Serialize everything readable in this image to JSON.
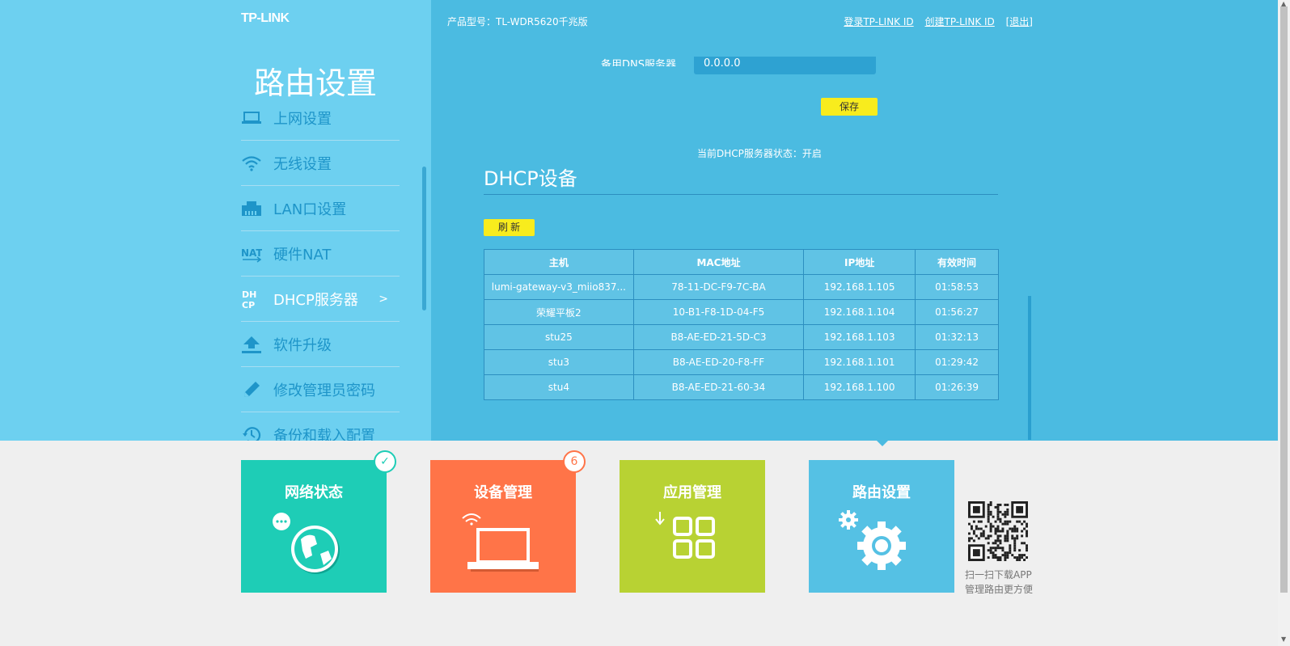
{
  "header": {
    "logo": "TP-LINK",
    "model": "产品型号：TL-WDR5620千兆版",
    "links": [
      "登录TP-LINK ID",
      "创建TP-LINK ID",
      "[退出]"
    ]
  },
  "sidebar": {
    "title": "路由设置",
    "items": [
      {
        "label": "上网设置",
        "icon": "laptop-icon"
      },
      {
        "label": "无线设置",
        "icon": "wifi-icon"
      },
      {
        "label": "LAN口设置",
        "icon": "lan-port-icon"
      },
      {
        "label": "硬件NAT",
        "icon": "nat-icon"
      },
      {
        "label": "DHCP服务器",
        "icon": "dhcp-icon",
        "active": true,
        "arrow": ">"
      },
      {
        "label": "软件升级",
        "icon": "upload-icon"
      },
      {
        "label": "修改管理员密码",
        "icon": "pencil-icon"
      },
      {
        "label": "备份和载入配置",
        "icon": "history-icon"
      }
    ]
  },
  "main": {
    "dns_label": "备用DNS服务器",
    "dns_value": "0.0.0.0",
    "save_label": "保存",
    "dhcp_status": "当前DHCP服务器状态：开启",
    "dhcp_heading": "DHCP设备",
    "refresh_label": "刷 新",
    "table": {
      "headers": [
        "主机",
        "MAC地址",
        "IP地址",
        "有效时间"
      ],
      "rows": [
        [
          "lumi-gateway-v3_miio837...",
          "78-11-DC-F9-7C-BA",
          "192.168.1.105",
          "01:58:53"
        ],
        [
          "荣耀平板2",
          "10-B1-F8-1D-04-F5",
          "192.168.1.104",
          "01:56:27"
        ],
        [
          "stu25",
          "B8-AE-ED-21-5D-C3",
          "192.168.1.103",
          "01:32:13"
        ],
        [
          "stu3",
          "B8-AE-ED-20-F8-FF",
          "192.168.1.101",
          "01:29:42"
        ],
        [
          "stu4",
          "B8-AE-ED-21-60-34",
          "192.168.1.100",
          "01:26:39"
        ]
      ]
    }
  },
  "tiles": [
    {
      "title": "网络状态",
      "color": "#1ecdb6",
      "badge": "✓",
      "badge_color": "#1ecdb6"
    },
    {
      "title": "设备管理",
      "color": "#ff7448",
      "badge": "6",
      "badge_color": "#ff7448"
    },
    {
      "title": "应用管理",
      "color": "#b8d233"
    },
    {
      "title": "路由设置",
      "color": "#55c1e4"
    }
  ],
  "qr_text": [
    "扫一扫下载APP",
    "管理路由更方便"
  ]
}
